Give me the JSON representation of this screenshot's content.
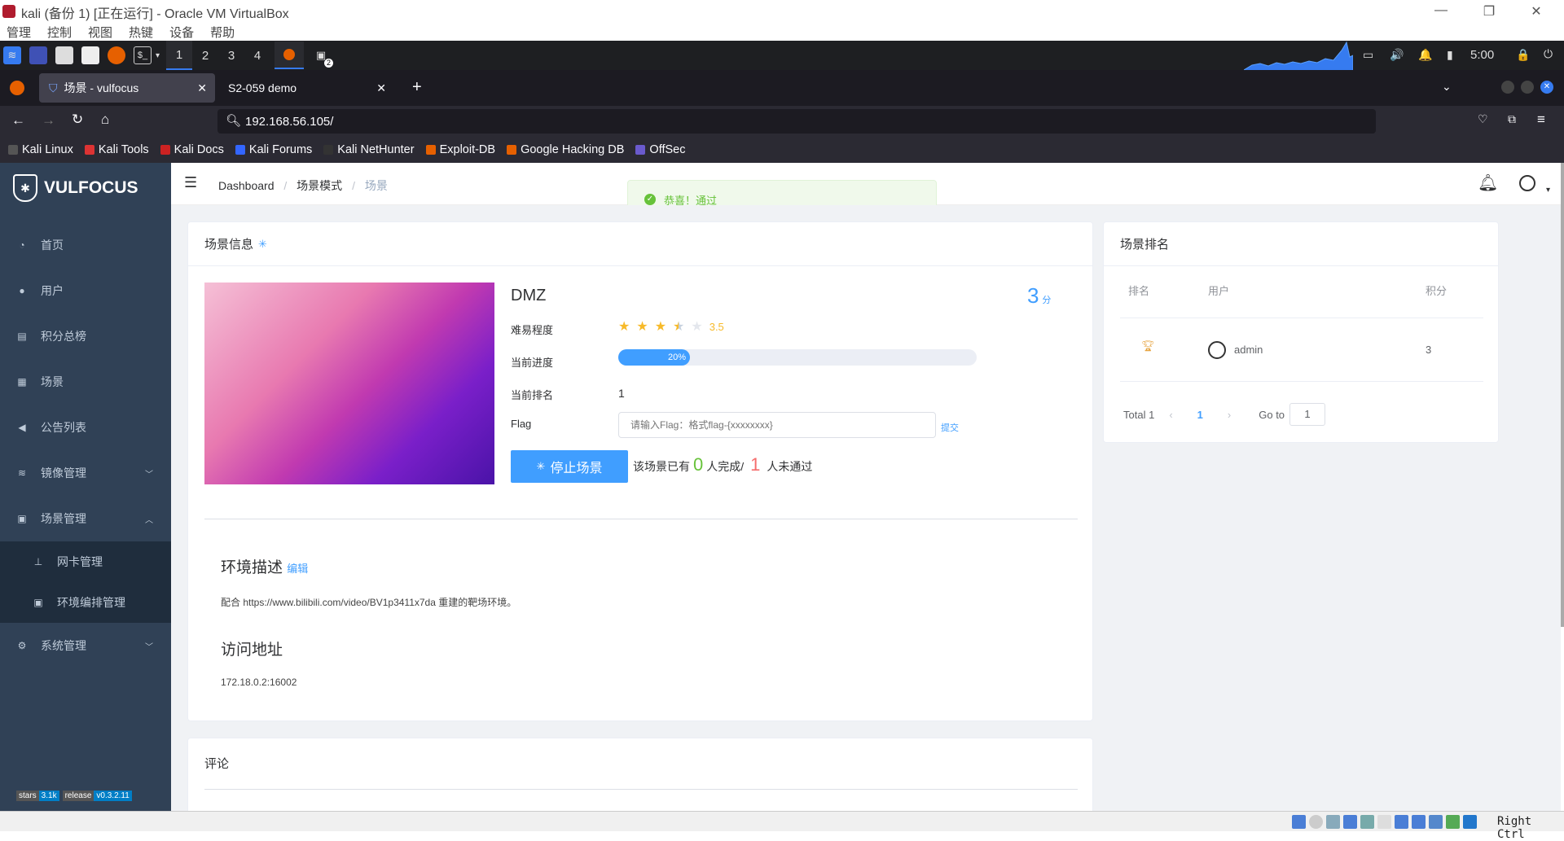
{
  "vbox": {
    "title": "kali (备份 1) [正在运行] - Oracle VM VirtualBox",
    "menu": [
      "管理",
      "控制",
      "视图",
      "热键",
      "设备",
      "帮助"
    ],
    "host_key": "Right Ctrl"
  },
  "panel": {
    "workspaces": [
      "1",
      "2",
      "3",
      "4"
    ],
    "clock": "5:00",
    "terminal_badge": "2"
  },
  "firefox": {
    "tabs": [
      {
        "label": "场景 - vulfocus"
      },
      {
        "label": "S2-059 demo"
      }
    ],
    "url": "192.168.56.105/",
    "bookmarks": [
      "Kali Linux",
      "Kali Tools",
      "Kali Docs",
      "Kali Forums",
      "Kali NetHunter",
      "Exploit-DB",
      "Google Hacking DB",
      "OffSec"
    ]
  },
  "sidebar": {
    "brand": "VULFOCUS",
    "items": [
      {
        "label": "首页"
      },
      {
        "label": "用户"
      },
      {
        "label": "积分总榜"
      },
      {
        "label": "场景"
      },
      {
        "label": "公告列表"
      },
      {
        "label": "镜像管理"
      },
      {
        "label": "场景管理"
      },
      {
        "label": "网卡管理"
      },
      {
        "label": "环境编排管理"
      },
      {
        "label": "系统管理"
      }
    ],
    "badges": {
      "stars_k": "stars",
      "stars_v": "3.1k",
      "rel_k": "release",
      "rel_v": "v0.3.2.11"
    }
  },
  "breadcrumb": [
    "Dashboard",
    "场景模式",
    "场景"
  ],
  "toast": "恭喜！通过",
  "scene": {
    "header": "场景信息",
    "name": "DMZ",
    "score": "3",
    "score_unit": "分",
    "difficulty_label": "难易程度",
    "difficulty": 3.5,
    "difficulty_text": "3.5",
    "progress_label": "当前进度",
    "progress": 0.2,
    "progress_text": "20%",
    "rank_label": "当前排名",
    "rank": "1",
    "flag_label": "Flag",
    "flag_placeholder": "请输入Flag：格式flag-{xxxxxxxx}",
    "submit": "提交",
    "stop_button": "停止场景",
    "stats_prefix": "该场景已有",
    "completed": "0",
    "completed_suffix": "人完成/",
    "failed": "1",
    "failed_suffix": "人未通过",
    "desc_title": "环境描述",
    "edit": "编辑",
    "desc": "配合 https://www.bilibili.com/video/BV1p3411x7da 重建的靶场环境。",
    "addr_title": "访问地址",
    "addr": "172.18.0.2:16002"
  },
  "ranking": {
    "header": "场景排名",
    "cols": [
      "排名",
      "用户",
      "积分"
    ],
    "rows": [
      {
        "user": "admin",
        "score": "3"
      }
    ],
    "total": "Total 1",
    "page": "1",
    "goto": "Go to",
    "goto_val": "1"
  },
  "comments": {
    "header": "评论"
  }
}
